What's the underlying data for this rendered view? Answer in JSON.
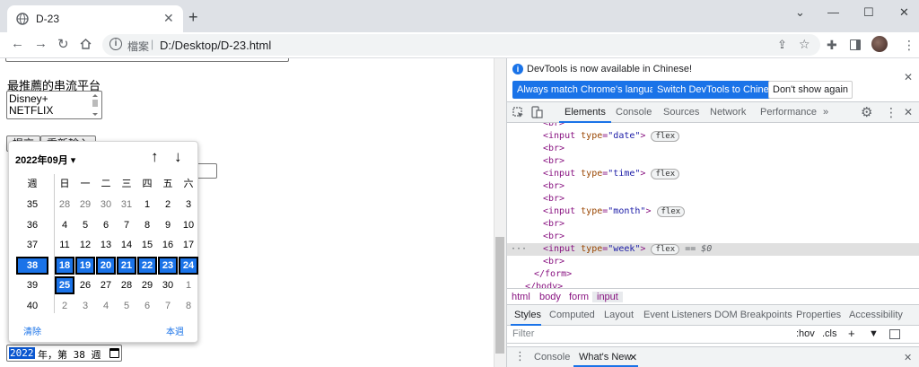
{
  "browser": {
    "tab_title": "D-23",
    "close_tab": "✕",
    "new_tab": "+",
    "url_scheme_label": "檔案",
    "url": "D:/Desktop/D-23.html",
    "window_controls": [
      "⌄",
      "—",
      "☐",
      "✕"
    ]
  },
  "page": {
    "label_stream": "最推薦的串流平台",
    "select_options": [
      "Disney+",
      "NETFLIX"
    ],
    "submit_button": "提交",
    "reset_button": "重新輸入",
    "week_input": {
      "year": "2022",
      "rest": "年，第 38 週"
    }
  },
  "calendar": {
    "month_label": "2022年09月 ▾",
    "up_arrow": "↑",
    "down_arrow": "↓",
    "headers": [
      "週",
      "日",
      "一",
      "二",
      "三",
      "四",
      "五",
      "六"
    ],
    "rows": [
      {
        "week": "35",
        "days": [
          "28",
          "29",
          "30",
          "31",
          "1",
          "2",
          "3"
        ],
        "other": [
          true,
          true,
          true,
          true,
          false,
          false,
          false
        ]
      },
      {
        "week": "36",
        "days": [
          "4",
          "5",
          "6",
          "7",
          "8",
          "9",
          "10"
        ],
        "other": [
          false,
          false,
          false,
          false,
          false,
          false,
          false
        ]
      },
      {
        "week": "37",
        "days": [
          "11",
          "12",
          "13",
          "14",
          "15",
          "16",
          "17"
        ],
        "other": [
          false,
          false,
          false,
          false,
          false,
          false,
          false
        ]
      },
      {
        "week": "38",
        "days": [
          "18",
          "19",
          "20",
          "21",
          "22",
          "23",
          "24"
        ],
        "other": [
          false,
          false,
          false,
          false,
          false,
          false,
          false
        ],
        "selected": true
      },
      {
        "week": "39",
        "days": [
          "25",
          "26",
          "27",
          "28",
          "29",
          "30",
          "1"
        ],
        "other": [
          false,
          false,
          false,
          false,
          false,
          false,
          true
        ],
        "today_index": 0
      },
      {
        "week": "40",
        "days": [
          "2",
          "3",
          "4",
          "5",
          "6",
          "7",
          "8"
        ],
        "other": [
          true,
          true,
          true,
          true,
          true,
          true,
          true
        ]
      }
    ],
    "clear_label": "清除",
    "this_week_label": "本週"
  },
  "devtools": {
    "info_message": "DevTools is now available in Chinese!",
    "match_language_button": "Always match Chrome's language",
    "switch_button": "Switch DevTools to Chinese",
    "dont_show_button": "Don't show again",
    "tabs": [
      "Elements",
      "Console",
      "Sources",
      "Network",
      "Performance",
      "»"
    ],
    "active_tab": "Elements",
    "dom_lines": [
      {
        "indent": 40,
        "tag": "<br>",
        "cut": true
      },
      {
        "indent": 40,
        "pre": "<input ",
        "attr": "type",
        "val": "\"date\"",
        "post": ">",
        "badge": "flex"
      },
      {
        "indent": 40,
        "tag": "<br>"
      },
      {
        "indent": 40,
        "tag": "<br>"
      },
      {
        "indent": 40,
        "pre": "<input ",
        "attr": "type",
        "val": "\"time\"",
        "post": ">",
        "badge": "flex"
      },
      {
        "indent": 40,
        "tag": "<br>"
      },
      {
        "indent": 40,
        "tag": "<br>"
      },
      {
        "indent": 40,
        "pre": "<input ",
        "attr": "type",
        "val": "\"month\"",
        "post": ">",
        "badge": "flex"
      },
      {
        "indent": 40,
        "tag": "<br>"
      },
      {
        "indent": 40,
        "tag": "<br>"
      },
      {
        "indent": 40,
        "pre": "<input ",
        "attr": "type",
        "val": "\"week\"",
        "post": ">",
        "badge": "flex",
        "dollar": "== $0",
        "highlight": true
      },
      {
        "indent": 40,
        "tag": "<br>"
      },
      {
        "indent": 30,
        "tag": "</form>"
      },
      {
        "indent": 20,
        "tag": "</body>"
      }
    ],
    "breadcrumbs": [
      "html",
      "body",
      "form",
      "input"
    ],
    "styles_tabs": [
      "Styles",
      "Computed",
      "Layout",
      "Event Listeners",
      "DOM Breakpoints",
      "Properties",
      "Accessibility"
    ],
    "filter_placeholder": "Filter",
    "filter_hov": ":hov",
    "filter_cls": ".cls",
    "drawer_tabs": [
      "Console",
      "What's New"
    ],
    "drawer_close": "✕"
  }
}
